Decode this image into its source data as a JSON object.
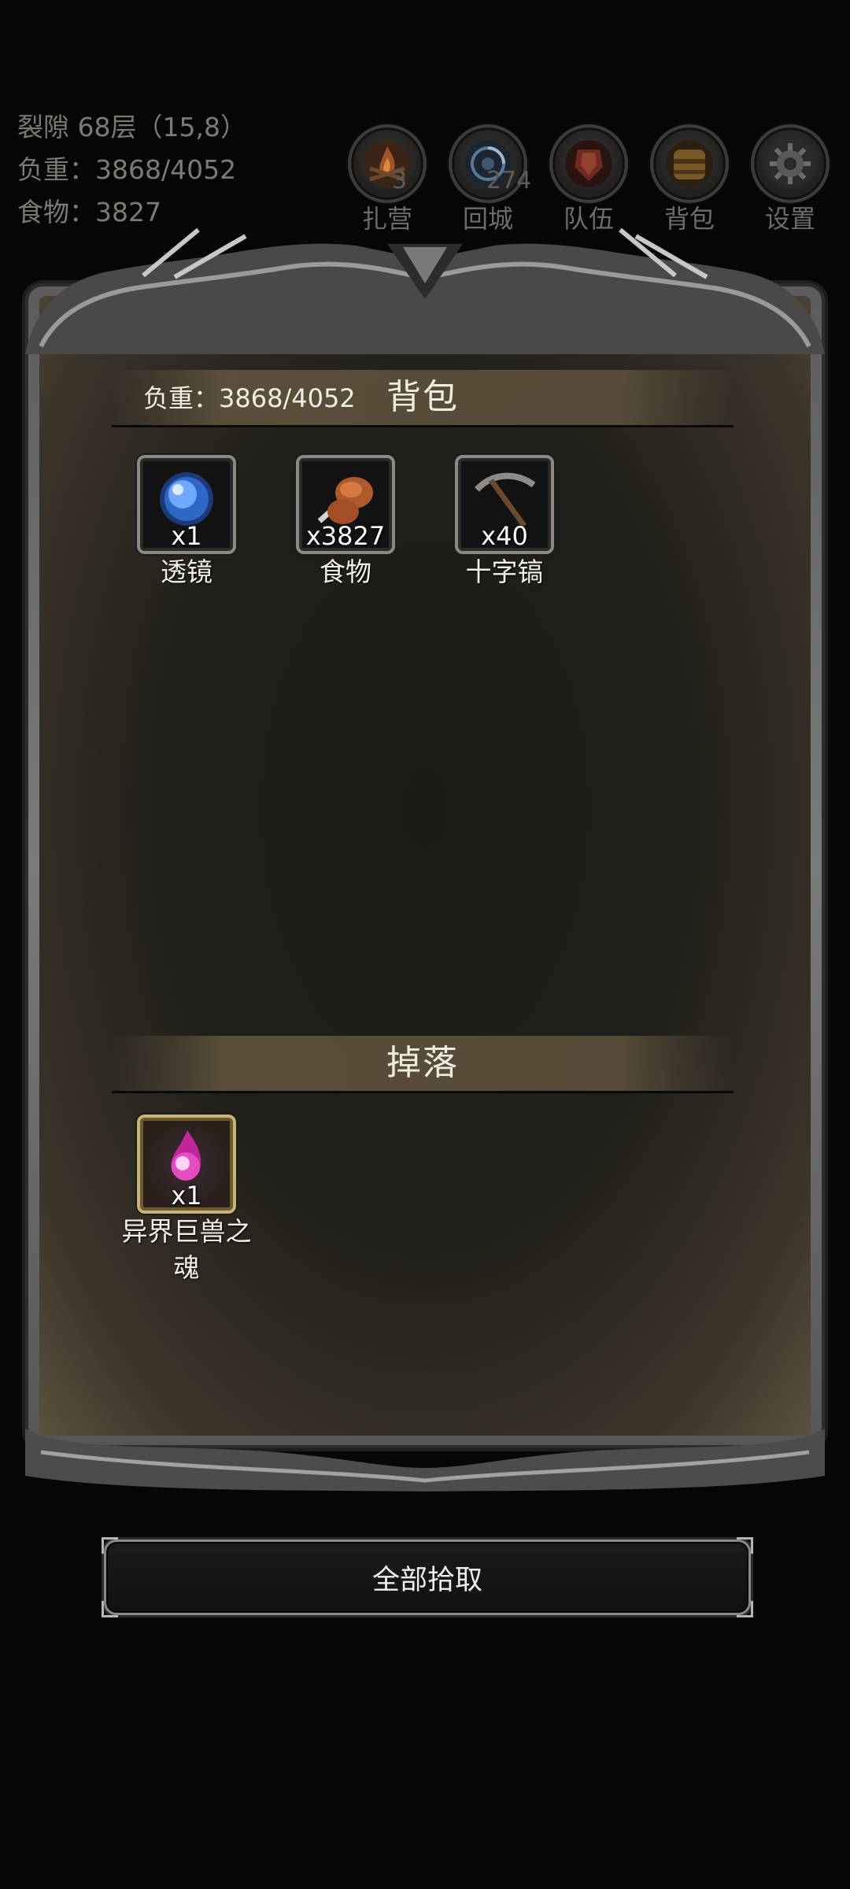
{
  "status": {
    "location": "裂隙 68层（15,8）",
    "weight": "负重：3868/4052",
    "food": "食物：3827"
  },
  "nav": [
    {
      "label": "扎营",
      "badge": "3",
      "icon": "campfire-icon"
    },
    {
      "label": "回城",
      "badge": "274",
      "icon": "portal-icon"
    },
    {
      "label": "队伍",
      "badge": "",
      "icon": "team-icon"
    },
    {
      "label": "背包",
      "badge": "",
      "icon": "backpack-icon"
    },
    {
      "label": "设置",
      "badge": "",
      "icon": "gear-icon"
    }
  ],
  "backpack": {
    "title": "背包",
    "weight": "负重：3868/4052",
    "items": [
      {
        "name": "透镜",
        "qty": "x1",
        "icon": "lens-orb-icon"
      },
      {
        "name": "食物",
        "qty": "x3827",
        "icon": "meat-icon"
      },
      {
        "name": "十字镐",
        "qty": "x40",
        "icon": "pickaxe-icon"
      }
    ]
  },
  "drops": {
    "title": "掉落",
    "items": [
      {
        "name": "异界巨兽之魂",
        "qty": "x1",
        "icon": "soul-flame-icon"
      }
    ]
  },
  "pickup_all": "全部拾取",
  "colors": {
    "parchment": "#211f1a",
    "frame_silver": "#7c7b7a",
    "rare_gold": "#c8b27a"
  }
}
